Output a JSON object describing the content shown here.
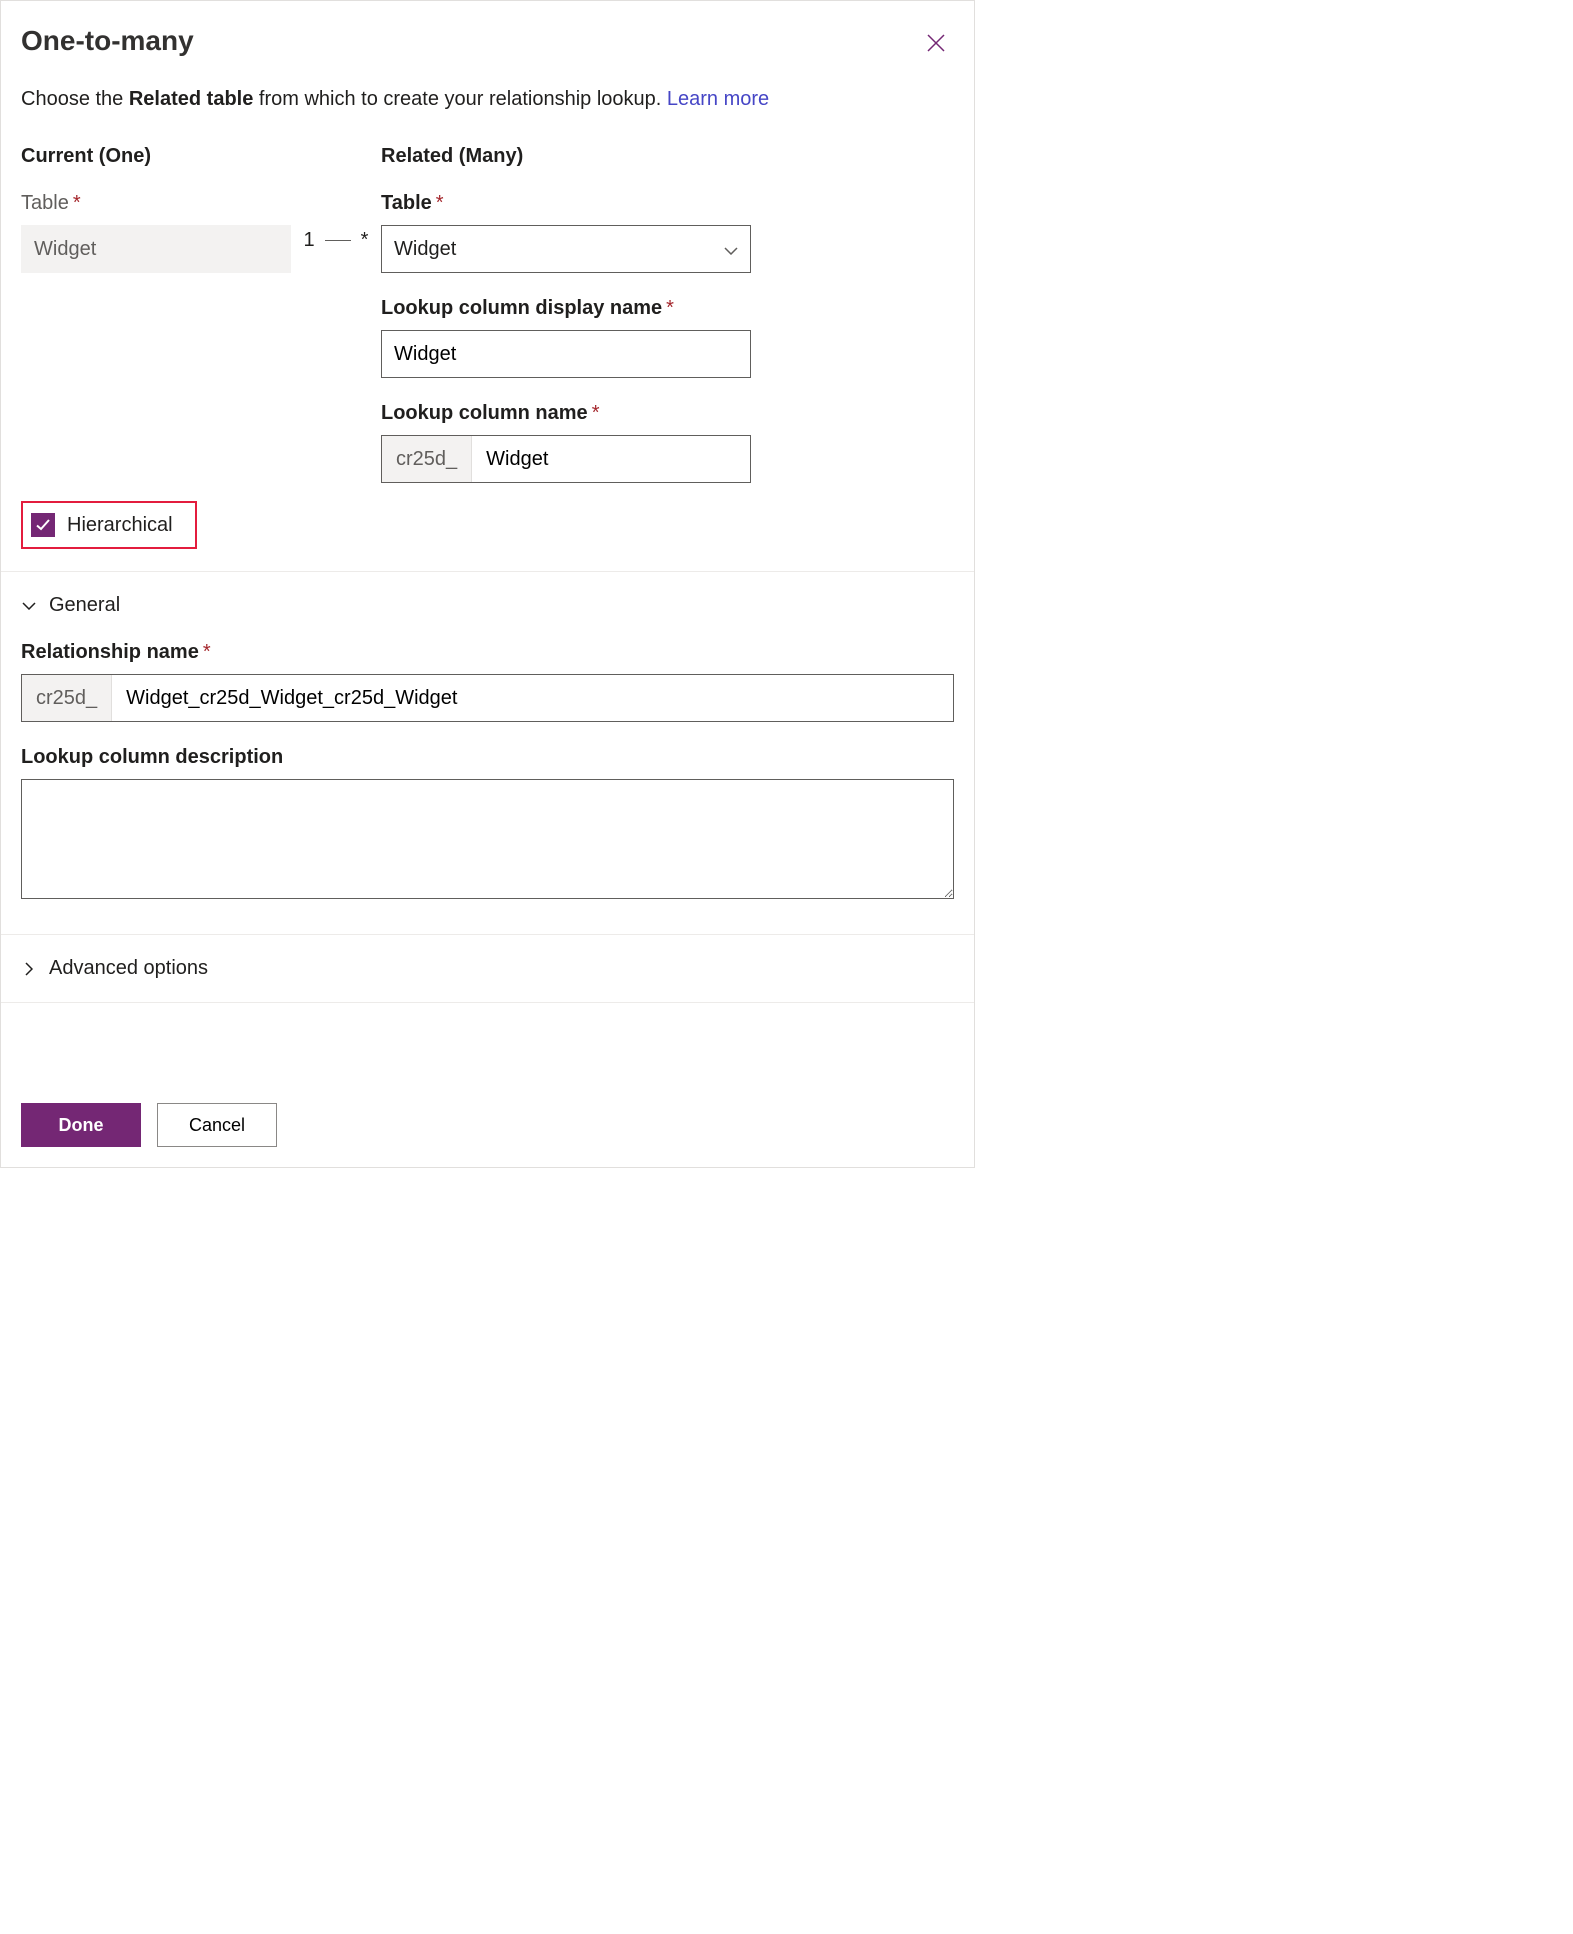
{
  "panel": {
    "title": "One-to-many",
    "description_prefix": "Choose the ",
    "description_bold": "Related table",
    "description_suffix": " from which to create your relationship lookup. ",
    "learn_more": "Learn more"
  },
  "current": {
    "heading": "Current (One)",
    "table_label": "Table",
    "table_value": "Widget"
  },
  "connector": {
    "left": "1",
    "right": "*"
  },
  "related": {
    "heading": "Related (Many)",
    "table_label": "Table",
    "table_value": "Widget",
    "lookup_display_label": "Lookup column display name",
    "lookup_display_value": "Widget",
    "lookup_name_label": "Lookup column name",
    "lookup_name_prefix": "cr25d_",
    "lookup_name_value": "Widget"
  },
  "checkbox": {
    "hierarchical_label": "Hierarchical",
    "checked": true
  },
  "general": {
    "expander_label": "General",
    "relationship_name_label": "Relationship name",
    "relationship_name_prefix": "cr25d_",
    "relationship_name_value": "Widget_cr25d_Widget_cr25d_Widget",
    "lookup_desc_label": "Lookup column description",
    "lookup_desc_value": ""
  },
  "advanced": {
    "expander_label": "Advanced options"
  },
  "footer": {
    "done": "Done",
    "cancel": "Cancel"
  }
}
